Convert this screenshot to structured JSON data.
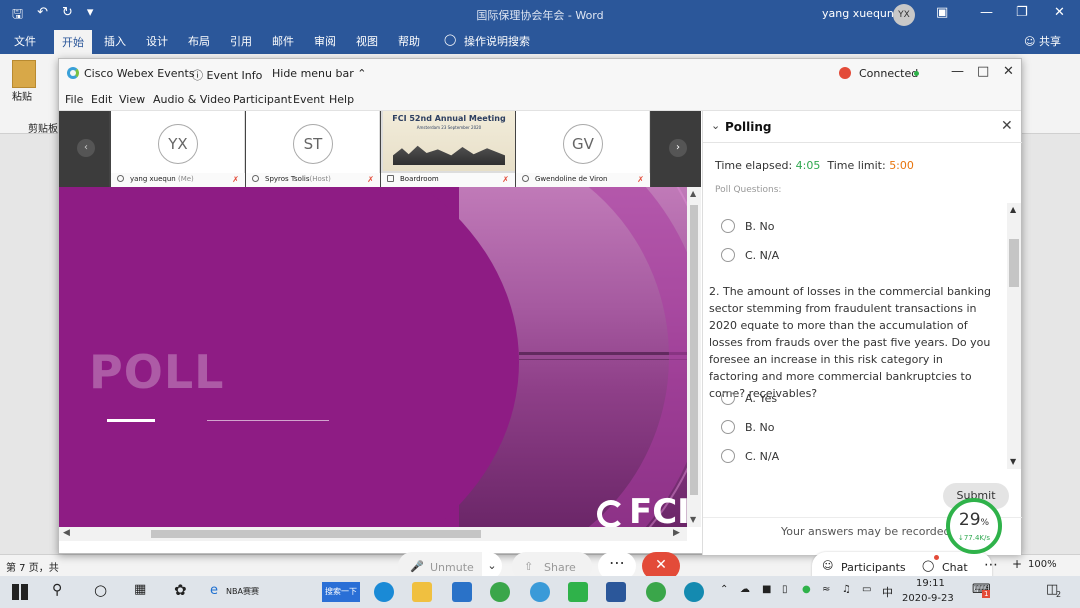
{
  "word": {
    "title": "国际保理协会年会 - Word",
    "user": "yang xuequn",
    "user_initials": "YX",
    "tabs": [
      "文件",
      "开始",
      "插入",
      "设计",
      "布局",
      "引用",
      "邮件",
      "审阅",
      "视图",
      "帮助"
    ],
    "tell_me": "操作说明搜索",
    "share": "共享",
    "paste_label": "粘贴",
    "clipboard_label": "剪贴板",
    "status_page": "第 7 页，共",
    "zoom": "100%"
  },
  "webex": {
    "app_name": "Cisco Webex Events",
    "event_info": "Event Info",
    "hide_menu": "Hide menu bar",
    "status": "Connected",
    "menu": [
      "File",
      "Edit",
      "View",
      "Audio & Video",
      "Participant",
      "Event",
      "Help"
    ],
    "participants": [
      {
        "initials": "YX",
        "name": "yang xuequn",
        "role": "(Me)"
      },
      {
        "initials": "ST",
        "name": "Spyros Tsolis",
        "role": "(Host)"
      },
      {
        "initials": "",
        "name": "Boardroom",
        "role": ""
      },
      {
        "initials": "GV",
        "name": "Gwendoline de Viron",
        "role": ""
      }
    ],
    "board_caption": "FCI 52nd Annual Meeting",
    "board_sub": "Amsterdam 23 September 2020",
    "slide": {
      "title": "POLL",
      "logo": "FCI"
    }
  },
  "polling": {
    "title": "Polling",
    "time_elapsed_label": "Time elapsed:",
    "time_elapsed": "4:05",
    "time_limit_label": "Time limit:",
    "time_limit": "5:00",
    "poll_questions_label": "Poll Questions:",
    "prev_options": [
      "B.  No",
      "C.  N/A"
    ],
    "question": "2.  The amount of losses in the commercial banking sector stemming from fraudulent transactions in 2020 equate to more than the accumulation of losses from frauds over the past five years.  Do you foresee an increase in this risk category in factoring and more commercial bankruptcies to come?  receivables?",
    "options": [
      "A.  Yes",
      "B.  No",
      "C.  N/A"
    ],
    "submit": "Submit",
    "recorded": "Your answers may be recorded."
  },
  "controls": {
    "unmute": "Unmute",
    "share": "Share",
    "participants": "Participants",
    "chat": "Chat"
  },
  "network": {
    "percent": "29",
    "unit": "%",
    "speed": "77.4K/s"
  },
  "taskbar": {
    "app1": "NBA赛赛",
    "search": "搜索一下",
    "ime": "中",
    "time": "19:11",
    "date": "2020-9-23",
    "notif": "2"
  }
}
